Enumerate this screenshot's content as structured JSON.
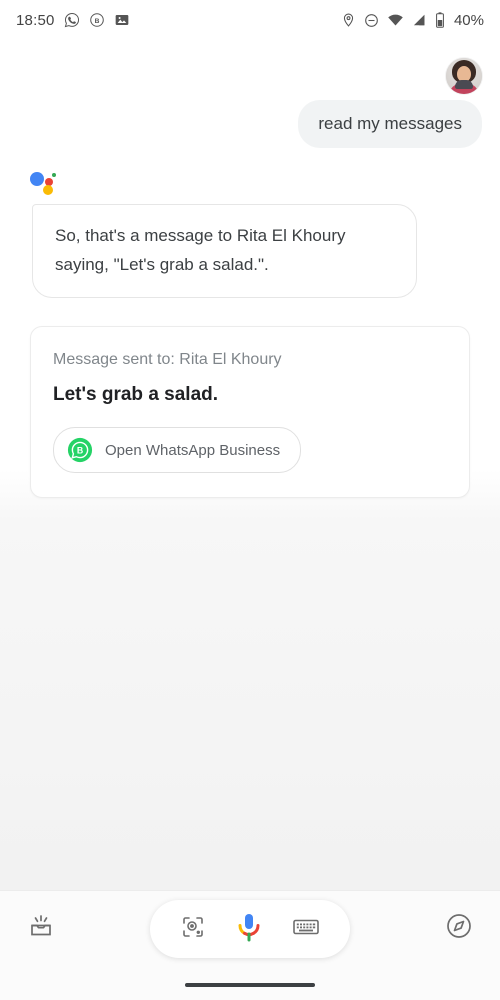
{
  "status_bar": {
    "clock": "18:50",
    "battery_percent": "40%",
    "left_icons": [
      "whatsapp-icon",
      "whatsapp-business-icon",
      "photo-icon"
    ],
    "right_icons": [
      "location-pin-icon",
      "do-not-disturb-icon",
      "wifi-icon",
      "cellular-signal-icon",
      "battery-icon"
    ]
  },
  "conversation": {
    "avatar_name": "user-avatar",
    "user_query": "read my messages",
    "assistant_logo": "google-assistant-icon",
    "assistant_reply": "So, that's a message to Rita El Khoury saying, \"Let's grab a salad.\"."
  },
  "card": {
    "recipient_label": "Message sent to: Rita El Khoury",
    "message_text": "Let's grab a salad.",
    "action_chip": {
      "icon": "whatsapp-business-icon",
      "label": "Open WhatsApp Business"
    }
  },
  "bottom_bar": {
    "snapshot_icon": "snapshot-inbox-icon",
    "lens_icon": "google-lens-icon",
    "mic_icon": "google-mic-icon",
    "keyboard_icon": "keyboard-icon",
    "explore_icon": "explore-compass-icon"
  },
  "colors": {
    "google_blue": "#4285f4",
    "google_red": "#ea4335",
    "google_yellow": "#fabb05",
    "google_green": "#34a853",
    "whatsapp_green": "#25d366",
    "bubble_gray": "#f1f3f4",
    "text_primary": "#202124",
    "text_secondary": "#5f6368"
  }
}
